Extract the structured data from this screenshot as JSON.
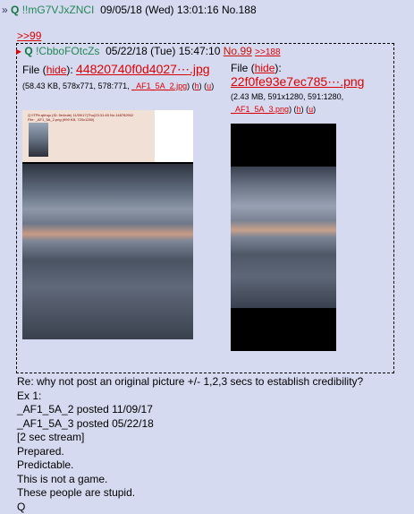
{
  "post": {
    "arrow": "»",
    "name": "Q",
    "trip": "!!mG7VJxZNCI",
    "date": "09/05/18 (Wed) 13:01:16",
    "number": "No.188"
  },
  "reply_link": ">>99",
  "quoted_post": {
    "marker": "▸",
    "name": "Q",
    "trip": "!CbboFOtcZs",
    "date": "05/22/18 (Tue) 15:47:10",
    "number": "No.99",
    "backlink": ">>188",
    "files": [
      {
        "label": "File",
        "hide": "hide",
        "filename": "44820740f0d4027⋯.jpg",
        "info_prefix": "(58.43 KB, 578x771, 578:771,",
        "orig_name": "_AF1_5A_2.jpg",
        "h": "h",
        "u": "u",
        "thumb_caption": "Q !ITPb.qbhqo (ID: 5e4ede) 11/09/17(Thu)23:31:45 No.148782902",
        "thumb_file": "File: _AF1_5A_2.png (999 KB, 720x1280)"
      },
      {
        "label": "File",
        "hide": "hide",
        "filename": "22f0fe93e7ec785⋯.png",
        "info_prefix": "(2.43 MB, 591x1280, 591:1280,",
        "orig_name": "_AF1_5A_3.png",
        "h": "h",
        "u": "u"
      }
    ]
  },
  "body_lines": [
    "Re: why not post an original picture +/- 1,2,3 secs to establish credibility?",
    "Ex 1:",
    "_AF1_5A_2 posted 11/09/17",
    "_AF1_5A_3 posted 05/22/18",
    "[2 sec stream]",
    "Prepared.",
    "Predictable.",
    "This is not a game.",
    "These people are stupid.",
    "Q"
  ]
}
